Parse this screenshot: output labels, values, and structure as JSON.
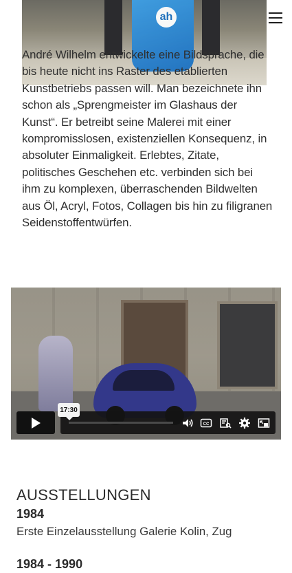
{
  "hero": {
    "bag_logo_text": "ah"
  },
  "intro": {
    "text": "André Wilhelm entwickelte eine Bildsprache, die bis heute nicht ins Raster des etablierten Kunstbetriebs passen will. Man bezeichnete ihn schon als „Sprengmeister im Glashaus der Kunst“. Er betreibt seine Malerei mit einer kompromisslosen, existenziellen Konsequenz, in absoluter Einmaligkeit. Erlebtes, Zitate, politisches Geschehen etc. verbinden sich bei ihm zu komplexen, überraschenden Bildwelten aus Öl, Acryl, Fotos, Collagen bis hin zu filigranen Seidenstoffentwürfen."
  },
  "video": {
    "duration": "17:30",
    "progress": 0.0,
    "icons": [
      "play-icon",
      "volume-icon",
      "captions-icon",
      "transcript-icon",
      "settings-icon",
      "pip-icon"
    ]
  },
  "exhibitions": {
    "title": "AUSSTELLUNGEN",
    "entries": [
      {
        "year": "1984",
        "text": "Erste Einzelausstellung Galerie Kolin, Zug"
      },
      {
        "year": "1984 - 1990",
        "text": ""
      }
    ]
  },
  "colors": {
    "text": "#2b2b2b",
    "control_bg": "#111111",
    "bag_blue": "#1a6fc0"
  }
}
